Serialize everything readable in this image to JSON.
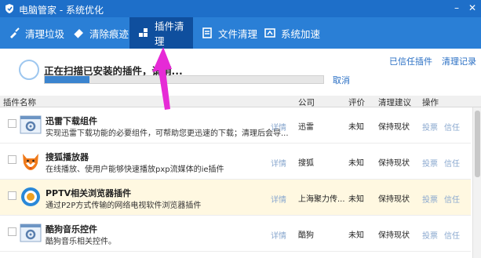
{
  "window": {
    "title": "电脑管家 - 系统优化"
  },
  "tabs": [
    {
      "label": "清理垃圾",
      "icon": "broom-icon"
    },
    {
      "label": "清除痕迹",
      "icon": "eraser-icon"
    },
    {
      "label": "插件清理",
      "icon": "plugin-icon",
      "active": true
    },
    {
      "label": "文件清理",
      "icon": "file-icon"
    },
    {
      "label": "系统加速",
      "icon": "rocket-icon"
    }
  ],
  "scan": {
    "status_text": "正在扫描已安装的插件，请稍...",
    "progress": 0.16,
    "cancel_label": "取消"
  },
  "top_links": {
    "trusted": "已信任插件",
    "records": "清理记录"
  },
  "table": {
    "headers": {
      "name": "插件名称",
      "company": "公司",
      "rating": "评价",
      "suggestion": "清理建议",
      "action": "操作"
    },
    "rows": [
      {
        "name": "迅雷下载组件",
        "desc": "实现迅雷下载功能的必要组件，可帮助您更迅速的下载；清理后会导...",
        "detail": "详情",
        "company": "迅雷",
        "rating": "未知",
        "suggestion": "保持现状",
        "act1": "投票",
        "act2": "信任",
        "icon": "gear-window-icon"
      },
      {
        "name": "搜狐播放器",
        "desc": "在线播放、使用户能够快速播放pxp流媒体的ie插件",
        "detail": "详情",
        "company": "搜狐",
        "rating": "未知",
        "suggestion": "保持现状",
        "act1": "投票",
        "act2": "信任",
        "icon": "fox-icon"
      },
      {
        "name": "PPTV相关浏览器插件",
        "desc": "通过P2P方式传输的网络电视软件浏览器插件",
        "detail": "详情",
        "company": "上海聚力传...",
        "rating": "未知",
        "suggestion": "保持现状",
        "act1": "投票",
        "act2": "信任",
        "icon": "pptv-icon",
        "highlight": true
      },
      {
        "name": "酷狗音乐控件",
        "desc": "酷狗音乐相关控件。",
        "detail": "详情",
        "company": "酷狗",
        "rating": "未知",
        "suggestion": "保持现状",
        "act1": "投票",
        "act2": "信任",
        "icon": "gear-window-icon"
      }
    ]
  },
  "colors": {
    "titlebar": "#1e6fc9",
    "tabbar": "#2a7fd6",
    "active_tab": "#0f4f9e",
    "link": "#2a6fc4",
    "highlight_row": "#fff8e1",
    "arrow": "#e62ad6"
  }
}
